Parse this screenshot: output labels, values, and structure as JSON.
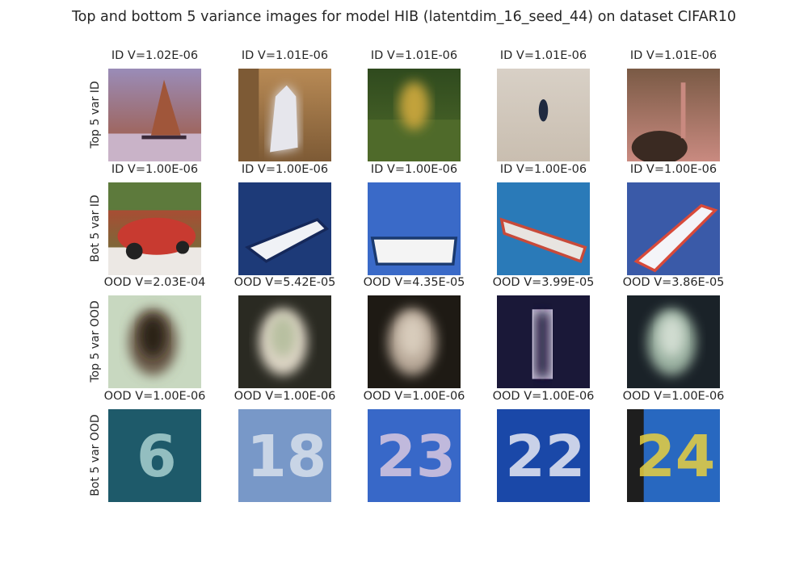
{
  "figure": {
    "title": "Top and bottom 5 variance images for model HIB (latentdim_16_seed_44) on dataset CIFAR10"
  },
  "rows": [
    {
      "label": "Top 5 var ID",
      "cells": [
        {
          "title": "ID V=1.02E-06",
          "image": "sailboat",
          "colors": [
            "#9a8cb8",
            "#c9b3c8",
            "#a0563a"
          ]
        },
        {
          "title": "ID V=1.01E-06",
          "image": "white-animal",
          "colors": [
            "#b88a55",
            "#e6e6ec",
            "#7d5a35"
          ]
        },
        {
          "title": "ID V=1.01E-06",
          "image": "deer-in-grass",
          "colors": [
            "#2f4a1e",
            "#c2a23a",
            "#4f6a2a"
          ]
        },
        {
          "title": "ID V=1.01E-06",
          "image": "bird-in-sky",
          "colors": [
            "#d8d0c6",
            "#1f2a40",
            "#c9beb0"
          ]
        },
        {
          "title": "ID V=1.01E-06",
          "image": "ostrich",
          "colors": [
            "#7a5a45",
            "#3a2a22",
            "#c98a80"
          ]
        }
      ]
    },
    {
      "label": "Bot 5 var ID",
      "cells": [
        {
          "title": "ID V=1.00E-06",
          "image": "red-car",
          "colors": [
            "#c83a30",
            "#ece8e4",
            "#5d7a3c"
          ]
        },
        {
          "title": "ID V=1.00E-06",
          "image": "cruise-ship",
          "colors": [
            "#1d3a78",
            "#f0f2f6",
            "#15285a"
          ]
        },
        {
          "title": "ID V=1.00E-06",
          "image": "ferry-ship",
          "colors": [
            "#3a6ac8",
            "#f4f4f4",
            "#1a3a70"
          ]
        },
        {
          "title": "ID V=1.00E-06",
          "image": "cargo-ship",
          "colors": [
            "#2a7ab8",
            "#e8e4e0",
            "#c84a3a"
          ]
        },
        {
          "title": "ID V=1.00E-06",
          "image": "speedboat",
          "colors": [
            "#3a5aa8",
            "#f4f4f8",
            "#d84a3a"
          ]
        }
      ]
    },
    {
      "label": "Top 5 var OOD",
      "cells": [
        {
          "title": "OOD V=2.03E-04",
          "image": "blurry-face",
          "colors": [
            "#6a5a4a",
            "#c8d8c0",
            "#2a2018"
          ]
        },
        {
          "title": "OOD V=5.42E-05",
          "image": "blurry-digit",
          "colors": [
            "#dcd4c4",
            "#2a2a22",
            "#b8c0a0"
          ]
        },
        {
          "title": "OOD V=4.35E-05",
          "image": "blurry-digit",
          "colors": [
            "#b8a898",
            "#1e1a14",
            "#d8ccbc"
          ]
        },
        {
          "title": "OOD V=3.99E-05",
          "image": "blurry-digit-one",
          "colors": [
            "#e4dcec",
            "#1a1838",
            "#c8c0d8"
          ]
        },
        {
          "title": "OOD V=3.86E-05",
          "image": "blurry-digit",
          "colors": [
            "#9ab0a0",
            "#1a2228",
            "#d0dcd0"
          ]
        }
      ]
    },
    {
      "label": "Bot 5 var OOD",
      "cells": [
        {
          "title": "OOD V=1.00E-06",
          "image": "house-number",
          "text": "6",
          "colors": [
            "#1e5a6a",
            "#a8d0d0",
            "#14404e"
          ]
        },
        {
          "title": "OOD V=1.00E-06",
          "image": "house-number",
          "text": "18",
          "colors": [
            "#7898c8",
            "#d8e0ec",
            "#3a58a0"
          ]
        },
        {
          "title": "OOD V=1.00E-06",
          "image": "house-number",
          "text": "23",
          "colors": [
            "#3868c8",
            "#d8c8e0",
            "#2850a8"
          ]
        },
        {
          "title": "OOD V=1.00E-06",
          "image": "house-number",
          "text": "22",
          "colors": [
            "#1a48a8",
            "#e8eaf4",
            "#123a8a"
          ]
        },
        {
          "title": "OOD V=1.00E-06",
          "image": "house-number",
          "text": "24",
          "colors": [
            "#2868c0",
            "#e8d040",
            "#1e1e1e"
          ]
        }
      ]
    }
  ]
}
